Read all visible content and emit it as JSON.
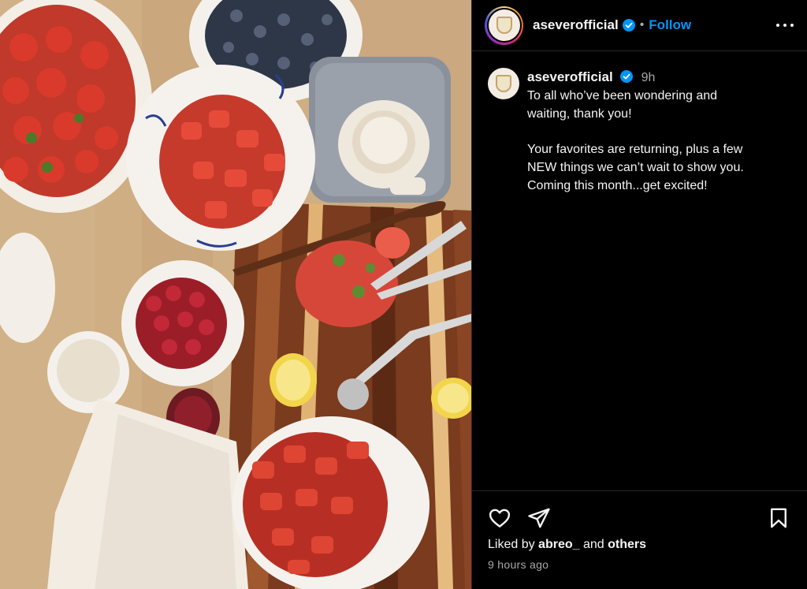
{
  "header": {
    "username": "aseverofficial",
    "verified_icon": "verified-badge-icon",
    "separator": "•",
    "follow_label": "Follow",
    "more_icon": "more-options-icon"
  },
  "caption": {
    "username": "aseverofficial",
    "time": "9h",
    "lines_1": [
      "To all who’ve been wondering and",
      "waiting, thank you!"
    ],
    "lines_2": [
      "Your favorites are returning, plus a few",
      "NEW things we can’t wait to show you.",
      "Coming this month...get excited!"
    ]
  },
  "actions": {
    "like_icon": "heart-icon",
    "share_icon": "send-icon",
    "save_icon": "bookmark-icon"
  },
  "likes": {
    "prefix": "Liked by",
    "user": "abreo_",
    "middle": "and",
    "suffix": "others"
  },
  "timestamp": "9 hours ago",
  "colors": {
    "accent": "#0095f6",
    "background": "#000000",
    "muted": "#a8a8a8"
  }
}
